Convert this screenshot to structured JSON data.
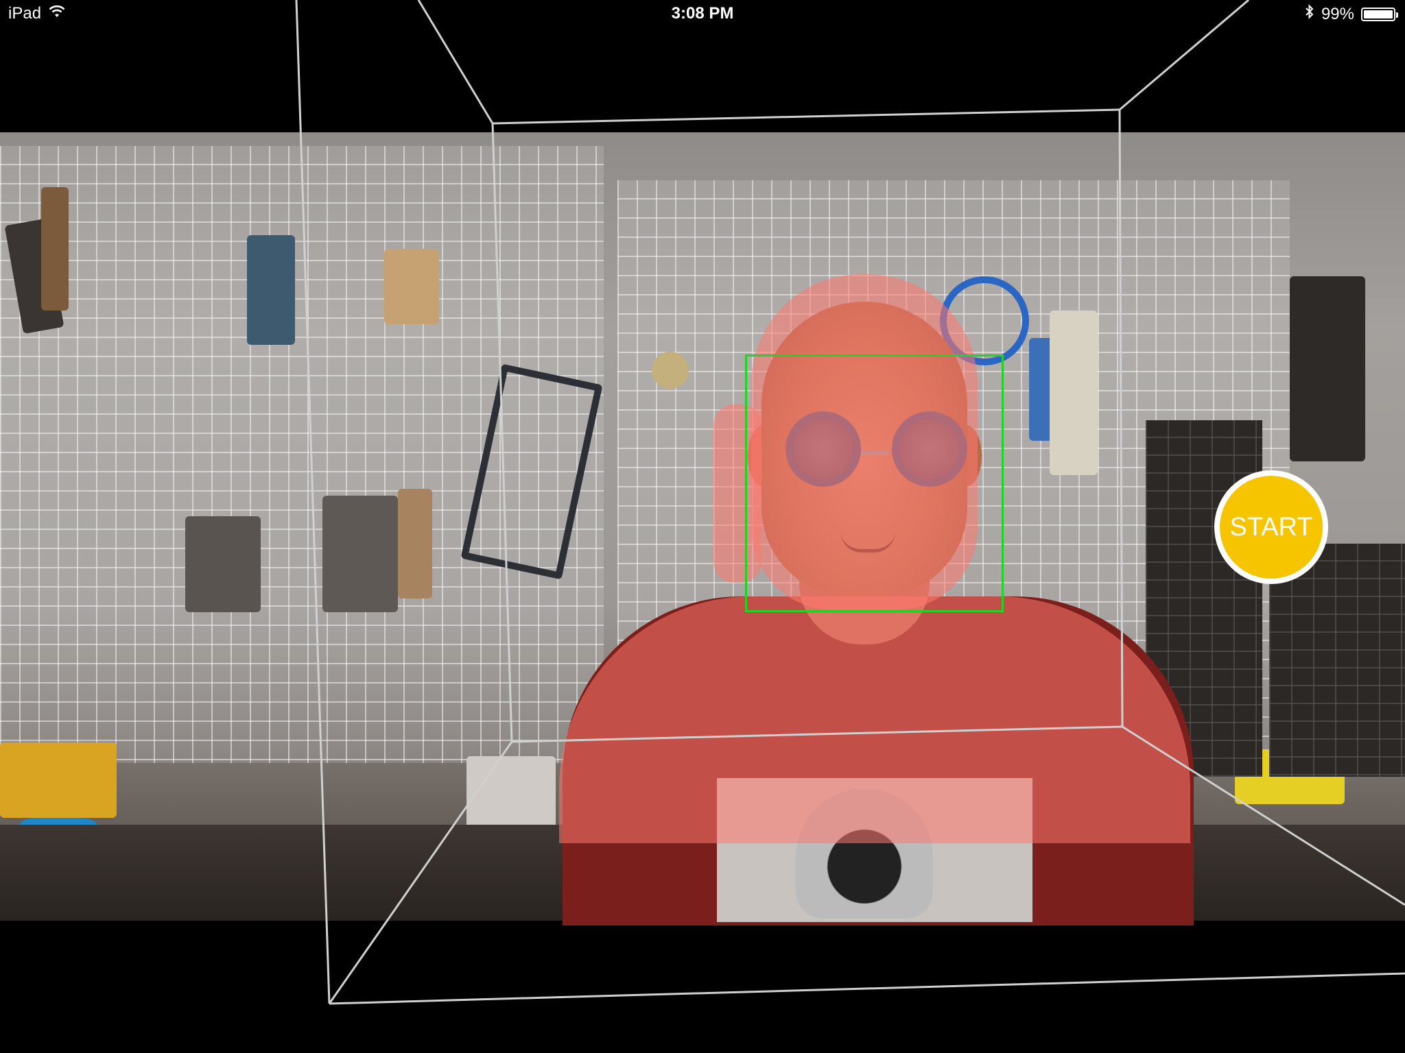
{
  "status_bar": {
    "device": "iPad",
    "time": "3:08 PM",
    "battery_percent": "99%",
    "battery_level": 0.99,
    "icons": [
      "wifi-icon",
      "bluetooth-icon",
      "battery-icon"
    ]
  },
  "camera": {
    "face_box_color": "#22d422",
    "person_mask_color": "#ff786e",
    "cube_line_color": "#d0d0d0"
  },
  "controls": {
    "start_label": "START",
    "start_color": "#f7c400"
  }
}
